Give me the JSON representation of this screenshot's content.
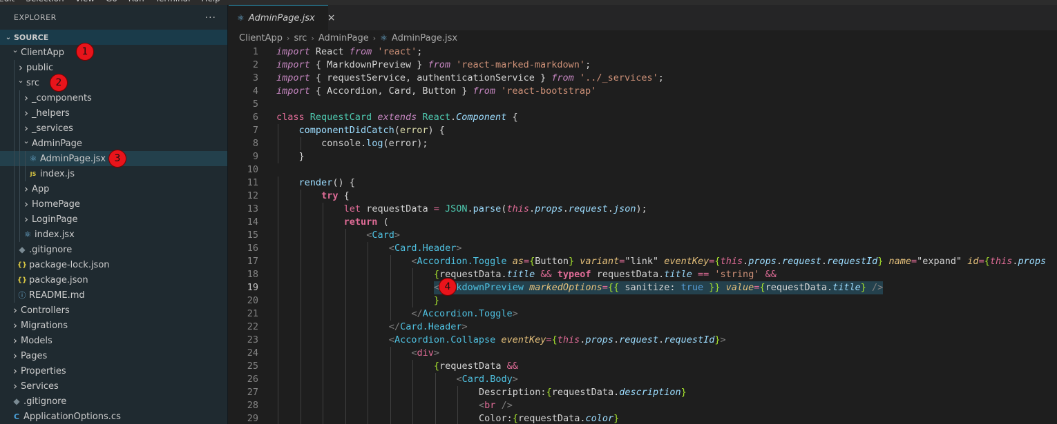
{
  "menu": [
    "Edit",
    "Selection",
    "View",
    "Go",
    "Run",
    "Terminal",
    "Help"
  ],
  "explorer": {
    "title": "EXPLORER",
    "more_label": "···",
    "section": "SOURCE",
    "items": [
      {
        "label": "ClientApp",
        "type": "folder-open",
        "depth": 1
      },
      {
        "label": "public",
        "type": "folder",
        "depth": 2
      },
      {
        "label": "src",
        "type": "folder-open",
        "depth": 2
      },
      {
        "label": "_components",
        "type": "folder",
        "depth": 3
      },
      {
        "label": "_helpers",
        "type": "folder",
        "depth": 3
      },
      {
        "label": "_services",
        "type": "folder",
        "depth": 3
      },
      {
        "label": "AdminPage",
        "type": "folder-open",
        "depth": 3
      },
      {
        "label": "AdminPage.jsx",
        "type": "react",
        "depth": 4,
        "selected": true
      },
      {
        "label": "index.js",
        "type": "js",
        "depth": 4
      },
      {
        "label": "App",
        "type": "folder",
        "depth": 3
      },
      {
        "label": "HomePage",
        "type": "folder",
        "depth": 3
      },
      {
        "label": "LoginPage",
        "type": "folder",
        "depth": 3
      },
      {
        "label": "index.jsx",
        "type": "react",
        "depth": 3
      },
      {
        "label": ".gitignore",
        "type": "git",
        "depth": 2
      },
      {
        "label": "package-lock.json",
        "type": "json",
        "depth": 2
      },
      {
        "label": "package.json",
        "type": "json",
        "depth": 2
      },
      {
        "label": "README.md",
        "type": "info",
        "depth": 2
      },
      {
        "label": "Controllers",
        "type": "folder",
        "depth": 1
      },
      {
        "label": "Migrations",
        "type": "folder",
        "depth": 1
      },
      {
        "label": "Models",
        "type": "folder",
        "depth": 1
      },
      {
        "label": "Pages",
        "type": "folder",
        "depth": 1
      },
      {
        "label": "Properties",
        "type": "folder",
        "depth": 1
      },
      {
        "label": "Services",
        "type": "folder",
        "depth": 1
      },
      {
        "label": ".gitignore",
        "type": "git",
        "depth": 1
      },
      {
        "label": "ApplicationOptions.cs",
        "type": "cs",
        "depth": 1
      }
    ]
  },
  "markers": [
    "1",
    "2",
    "3",
    "4"
  ],
  "tab": {
    "label": "AdminPage.jsx",
    "close": "×"
  },
  "breadcrumb": [
    "ClientApp",
    "src",
    "AdminPage",
    "AdminPage.jsx"
  ],
  "active_line": 19,
  "code": [
    {
      "n": 1,
      "indent": 0,
      "t": [
        [
          "kw",
          "import"
        ],
        [
          "plain",
          " React "
        ],
        [
          "kw",
          "from"
        ],
        [
          "plain",
          " "
        ],
        [
          "str",
          "'react'"
        ],
        [
          "plain",
          ";"
        ]
      ]
    },
    {
      "n": 2,
      "indent": 0,
      "t": [
        [
          "kw",
          "import"
        ],
        [
          "plain",
          " { MarkdownPreview } "
        ],
        [
          "kw",
          "from"
        ],
        [
          "plain",
          " "
        ],
        [
          "str",
          "'react-marked-markdown'"
        ],
        [
          "plain",
          ";"
        ]
      ]
    },
    {
      "n": 3,
      "indent": 0,
      "t": [
        [
          "kw",
          "import"
        ],
        [
          "plain",
          " { requestService, authenticationService } "
        ],
        [
          "kw",
          "from"
        ],
        [
          "plain",
          " "
        ],
        [
          "str",
          "'../_services'"
        ],
        [
          "plain",
          ";"
        ]
      ]
    },
    {
      "n": 4,
      "indent": 0,
      "t": [
        [
          "kw",
          "import"
        ],
        [
          "plain",
          " { Accordion, Card, Button } "
        ],
        [
          "kw",
          "from"
        ],
        [
          "plain",
          " "
        ],
        [
          "str",
          "'react-bootstrap'"
        ]
      ]
    },
    {
      "n": 5,
      "indent": 0,
      "t": []
    },
    {
      "n": 6,
      "indent": 0,
      "t": [
        [
          "kwp",
          "class"
        ],
        [
          "plain",
          " "
        ],
        [
          "cls",
          "RequestCard"
        ],
        [
          "plain",
          " "
        ],
        [
          "kw",
          "extends"
        ],
        [
          "plain",
          " "
        ],
        [
          "cls",
          "React"
        ],
        [
          "plain",
          "."
        ],
        [
          "prop",
          "Component"
        ],
        [
          "plain",
          " {"
        ]
      ]
    },
    {
      "n": 7,
      "indent": 1,
      "t": [
        [
          "var",
          "componentDidCatch"
        ],
        [
          "plain",
          "("
        ],
        [
          "fn",
          "error"
        ],
        [
          "plain",
          ") {"
        ]
      ]
    },
    {
      "n": 8,
      "indent": 2,
      "t": [
        [
          "plain",
          "console."
        ],
        [
          "var",
          "log"
        ],
        [
          "plain",
          "(error);"
        ]
      ]
    },
    {
      "n": 9,
      "indent": 1,
      "t": [
        [
          "plain",
          "}"
        ]
      ]
    },
    {
      "n": 10,
      "indent": 0,
      "t": []
    },
    {
      "n": 11,
      "indent": 1,
      "t": [
        [
          "var",
          "render"
        ],
        [
          "plain",
          "() {"
        ]
      ]
    },
    {
      "n": 12,
      "indent": 2,
      "t": [
        [
          "kwn",
          "try"
        ],
        [
          "plain",
          " {"
        ]
      ]
    },
    {
      "n": 13,
      "indent": 3,
      "t": [
        [
          "kwp",
          "let"
        ],
        [
          "plain",
          " requestData "
        ],
        [
          "kwp",
          "="
        ],
        [
          "plain",
          " "
        ],
        [
          "cls",
          "JSON"
        ],
        [
          "plain",
          "."
        ],
        [
          "var",
          "parse"
        ],
        [
          "plain",
          "("
        ],
        [
          "this",
          "this"
        ],
        [
          "plain",
          "."
        ],
        [
          "prop",
          "props"
        ],
        [
          "plain",
          "."
        ],
        [
          "prop",
          "request"
        ],
        [
          "plain",
          "."
        ],
        [
          "prop",
          "json"
        ],
        [
          "plain",
          ");"
        ]
      ]
    },
    {
      "n": 14,
      "indent": 3,
      "t": [
        [
          "kwn",
          "return"
        ],
        [
          "plain",
          " ("
        ]
      ]
    },
    {
      "n": 15,
      "indent": 4,
      "t": [
        [
          "ang",
          "<"
        ],
        [
          "tag",
          "Card"
        ],
        [
          "ang",
          ">"
        ]
      ]
    },
    {
      "n": 16,
      "indent": 5,
      "t": [
        [
          "ang",
          "<"
        ],
        [
          "tag",
          "Card.Header"
        ],
        [
          "ang",
          ">"
        ]
      ]
    },
    {
      "n": 17,
      "indent": 6,
      "t": [
        [
          "ang",
          "<"
        ],
        [
          "tag",
          "Accordion.Toggle"
        ],
        [
          "plain",
          " "
        ],
        [
          "attr",
          "as"
        ],
        [
          "kwp",
          "="
        ],
        [
          "brc",
          "{"
        ],
        [
          "plain",
          "Button"
        ],
        [
          "brc",
          "}"
        ],
        [
          "plain",
          " "
        ],
        [
          "attr",
          "variant"
        ],
        [
          "kwp",
          "="
        ],
        [
          "plain",
          "\"link\" "
        ],
        [
          "attr",
          "eventKey"
        ],
        [
          "kwp",
          "="
        ],
        [
          "brc",
          "{"
        ],
        [
          "this",
          "this"
        ],
        [
          "plain",
          "."
        ],
        [
          "prop",
          "props"
        ],
        [
          "plain",
          "."
        ],
        [
          "prop",
          "request"
        ],
        [
          "plain",
          "."
        ],
        [
          "prop",
          "requestId"
        ],
        [
          "brc",
          "}"
        ],
        [
          "plain",
          " "
        ],
        [
          "attr",
          "name"
        ],
        [
          "kwp",
          "="
        ],
        [
          "plain",
          "\"expand\" "
        ],
        [
          "attr",
          "id"
        ],
        [
          "kwp",
          "="
        ],
        [
          "brc",
          "{"
        ],
        [
          "this",
          "this"
        ],
        [
          "plain",
          "."
        ],
        [
          "prop",
          "props"
        ]
      ]
    },
    {
      "n": 18,
      "indent": 7,
      "t": [
        [
          "brc",
          "{"
        ],
        [
          "plain",
          "requestData."
        ],
        [
          "prop",
          "title"
        ],
        [
          "plain",
          " "
        ],
        [
          "kwp",
          "&&"
        ],
        [
          "plain",
          " "
        ],
        [
          "kwn",
          "typeof"
        ],
        [
          "plain",
          " requestData."
        ],
        [
          "prop",
          "title"
        ],
        [
          "plain",
          " "
        ],
        [
          "kwp",
          "=="
        ],
        [
          "plain",
          " "
        ],
        [
          "str",
          "'string'"
        ],
        [
          "plain",
          " "
        ],
        [
          "kwp",
          "&&"
        ]
      ]
    },
    {
      "n": 19,
      "indent": 7,
      "hl": true,
      "t": [
        [
          "ang",
          "<"
        ],
        [
          "tag",
          "MarkdownPreview"
        ],
        [
          "plain",
          " "
        ],
        [
          "attr",
          "markedOptions"
        ],
        [
          "kwp",
          "="
        ],
        [
          "brc",
          "{{"
        ],
        [
          "plain",
          " sanitize: "
        ],
        [
          "boolv",
          "true"
        ],
        [
          "plain",
          " "
        ],
        [
          "brc",
          "}}"
        ],
        [
          "plain",
          " "
        ],
        [
          "attr",
          "value"
        ],
        [
          "kwp",
          "="
        ],
        [
          "brc",
          "{"
        ],
        [
          "plain",
          "requestData."
        ],
        [
          "prop",
          "title"
        ],
        [
          "brc",
          "}"
        ],
        [
          "plain",
          " "
        ],
        [
          "ang",
          "/>"
        ]
      ]
    },
    {
      "n": 20,
      "indent": 7,
      "t": [
        [
          "brc",
          "}"
        ]
      ]
    },
    {
      "n": 21,
      "indent": 6,
      "t": [
        [
          "ang",
          "</"
        ],
        [
          "tag",
          "Accordion.Toggle"
        ],
        [
          "ang",
          ">"
        ]
      ]
    },
    {
      "n": 22,
      "indent": 5,
      "t": [
        [
          "ang",
          "</"
        ],
        [
          "tag",
          "Card.Header"
        ],
        [
          "ang",
          ">"
        ]
      ]
    },
    {
      "n": 23,
      "indent": 5,
      "t": [
        [
          "ang",
          "<"
        ],
        [
          "tag",
          "Accordion.Collapse"
        ],
        [
          "plain",
          " "
        ],
        [
          "attr",
          "eventKey"
        ],
        [
          "kwp",
          "="
        ],
        [
          "brc",
          "{"
        ],
        [
          "this",
          "this"
        ],
        [
          "plain",
          "."
        ],
        [
          "prop",
          "props"
        ],
        [
          "plain",
          "."
        ],
        [
          "prop",
          "request"
        ],
        [
          "plain",
          "."
        ],
        [
          "prop",
          "requestId"
        ],
        [
          "brc",
          "}"
        ],
        [
          "ang",
          ">"
        ]
      ]
    },
    {
      "n": 24,
      "indent": 6,
      "t": [
        [
          "ang",
          "<"
        ],
        [
          "kwp",
          "div"
        ],
        [
          "ang",
          ">"
        ]
      ]
    },
    {
      "n": 25,
      "indent": 7,
      "t": [
        [
          "brc",
          "{"
        ],
        [
          "plain",
          "requestData "
        ],
        [
          "kwp",
          "&&"
        ]
      ]
    },
    {
      "n": 26,
      "indent": 8,
      "t": [
        [
          "ang",
          "<"
        ],
        [
          "tag",
          "Card.Body"
        ],
        [
          "ang",
          ">"
        ]
      ]
    },
    {
      "n": 27,
      "indent": 9,
      "t": [
        [
          "plain",
          "Description:"
        ],
        [
          "brc",
          "{"
        ],
        [
          "plain",
          "requestData."
        ],
        [
          "prop",
          "description"
        ],
        [
          "brc",
          "}"
        ]
      ]
    },
    {
      "n": 28,
      "indent": 9,
      "t": [
        [
          "ang",
          "<"
        ],
        [
          "kwp",
          "br"
        ],
        [
          "plain",
          " "
        ],
        [
          "ang",
          "/>"
        ]
      ]
    },
    {
      "n": 29,
      "indent": 9,
      "t": [
        [
          "plain",
          "Color:"
        ],
        [
          "brc",
          "{"
        ],
        [
          "plain",
          "requestData."
        ],
        [
          "prop",
          "color"
        ],
        [
          "brc",
          "}"
        ]
      ]
    }
  ]
}
